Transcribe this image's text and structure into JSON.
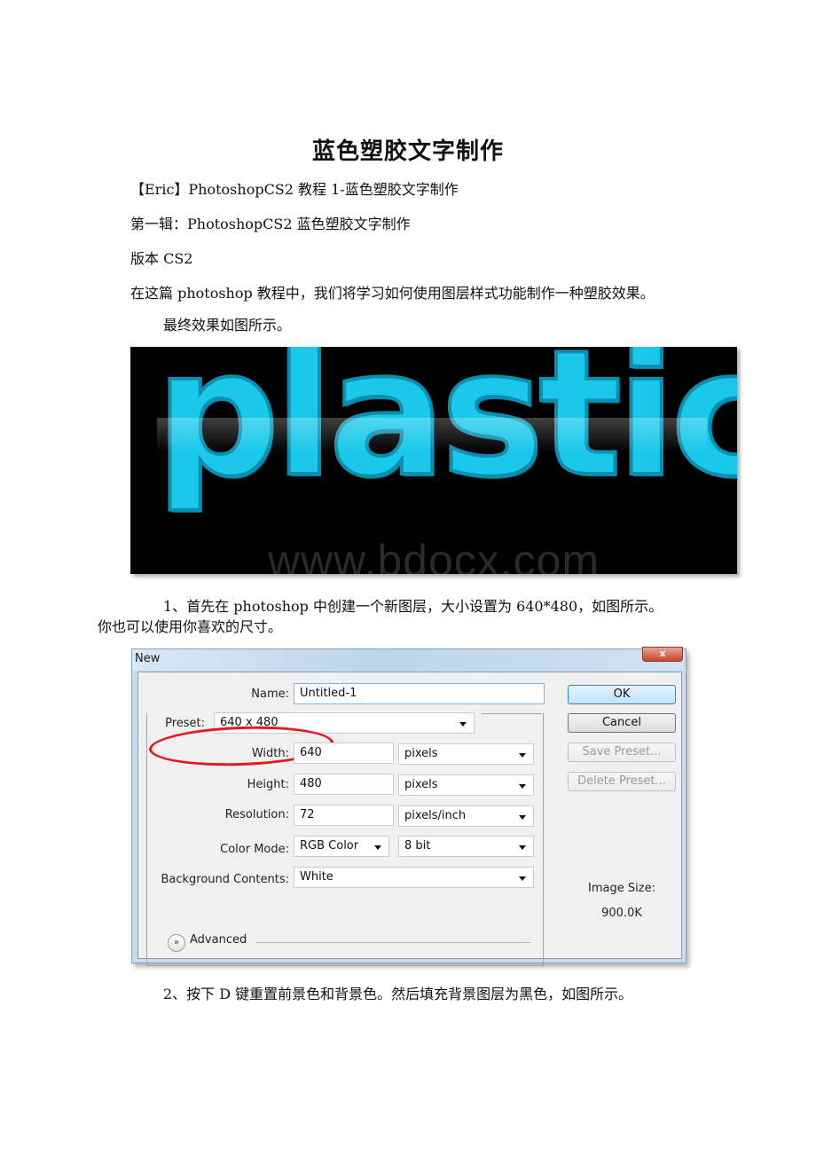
{
  "document": {
    "title": "蓝色塑胶文字制作",
    "paragraphs": [
      "【Eric】PhotoshopCS2 教程 1-蓝色塑胶文字制作",
      "第一辑：PhotoshopCS2 蓝色塑胶文字制作",
      "版本 CS2",
      "在这篇 photoshop 教程中，我们将学习如何使用图层样式功能制作一种塑胶效果。",
      "最终效果如图所示。"
    ],
    "step1_line1": "1、首先在 photoshop 中创建一个新图层，大小设置为 640*480，如图所示。",
    "step1_line2": "你也可以使用你喜欢的尺寸。",
    "step2": "2、按下 D 键重置前景色和背景色。然后填充背景图层为黑色，如图所示。"
  },
  "hero_image": {
    "word": "plastic",
    "watermark": "www.bdocx.com",
    "colors": {
      "text": "#19c8ea",
      "background": "#000000"
    }
  },
  "dialog": {
    "title": "New",
    "close_label": "x",
    "fields": {
      "name": {
        "label": "Name:",
        "value": "Untitled-1"
      },
      "preset": {
        "label": "Preset:",
        "value": "640 x 480"
      },
      "width": {
        "label": "Width:",
        "value": "640",
        "unit": "pixels"
      },
      "height": {
        "label": "Height:",
        "value": "480",
        "unit": "pixels"
      },
      "resolution": {
        "label": "Resolution:",
        "value": "72",
        "unit": "pixels/inch"
      },
      "color_mode": {
        "label": "Color Mode:",
        "value": "RGB Color",
        "depth": "8 bit"
      },
      "background": {
        "label": "Background Contents:",
        "value": "White"
      }
    },
    "buttons": {
      "ok": "OK",
      "cancel": "Cancel",
      "save_preset": "Save Preset...",
      "delete_preset": "Delete Preset..."
    },
    "advanced_label": "Advanced",
    "advanced_icon": "»",
    "image_size_label": "Image Size:",
    "image_size_value": "900.0K",
    "highlight_color": "#e8161a"
  }
}
